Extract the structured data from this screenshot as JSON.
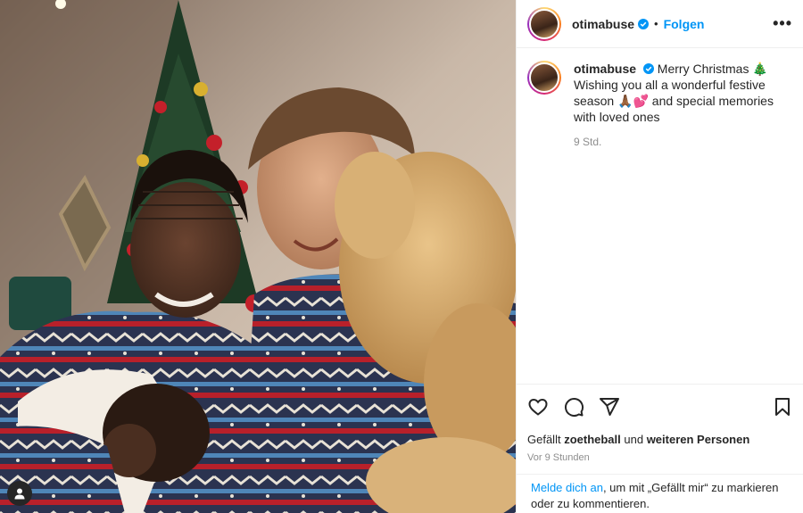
{
  "post": {
    "username": "otimabuse",
    "follow_label": "Folgen",
    "more_label": "•••",
    "dot": "•"
  },
  "caption": {
    "username": "otimabuse",
    "text": "Merry Christmas 🎄 Wishing you all a wonderful festive season 🙏🏾💕 and special memories with loved ones",
    "time": "9 Std."
  },
  "likes": {
    "prefix": "Gefällt ",
    "user": "zoetheball",
    "middle": " und ",
    "suffix": "weiteren Personen"
  },
  "posted": "Vor 9 Stunden",
  "login": {
    "link": "Melde dich an",
    "text": ", um mit „Gefällt mir“ zu markieren oder zu kommentieren."
  },
  "icons": {
    "like": "heart-icon",
    "comment": "comment-icon",
    "share": "send-icon",
    "save": "bookmark-icon",
    "tags": "user-tag-icon",
    "verified": "verified-badge-icon"
  },
  "colors": {
    "accent": "#0095f6",
    "secondary_text": "#8e8e8e",
    "border": "#efefef"
  }
}
